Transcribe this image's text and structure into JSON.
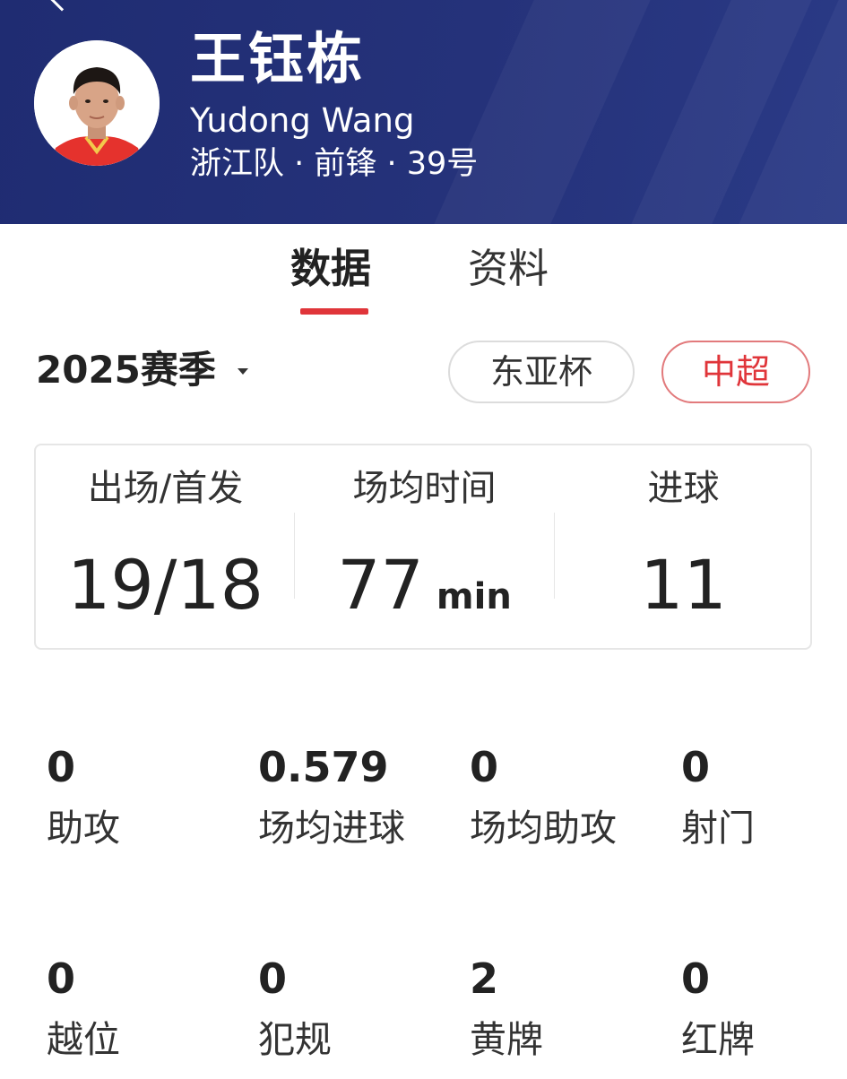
{
  "player": {
    "name_cn": "王钰栋",
    "name_en": "Yudong Wang",
    "info": "浙江队 · 前锋 · 39号"
  },
  "tabs": [
    {
      "label": "数据",
      "active": true
    },
    {
      "label": "资料",
      "active": false
    }
  ],
  "season": {
    "label": "2025赛季"
  },
  "competitions": [
    {
      "label": "东亚杯",
      "selected": false
    },
    {
      "label": "中超",
      "selected": true
    }
  ],
  "summary": [
    {
      "label": "出场/首发",
      "value": "19/18",
      "unit": ""
    },
    {
      "label": "场均时间",
      "value": "77",
      "unit": "min"
    },
    {
      "label": "进球",
      "value": "11",
      "unit": ""
    }
  ],
  "stats": [
    {
      "value": "0",
      "label": "助攻"
    },
    {
      "value": "0.579",
      "label": "场均进球"
    },
    {
      "value": "0",
      "label": "场均助攻"
    },
    {
      "value": "0",
      "label": "射门"
    },
    {
      "value": "0",
      "label": "越位"
    },
    {
      "value": "0",
      "label": "犯规"
    },
    {
      "value": "2",
      "label": "黄牌"
    },
    {
      "value": "0",
      "label": "红牌"
    }
  ],
  "colors": {
    "header_bg": "#25327a",
    "accent_red": "#e0353a"
  }
}
